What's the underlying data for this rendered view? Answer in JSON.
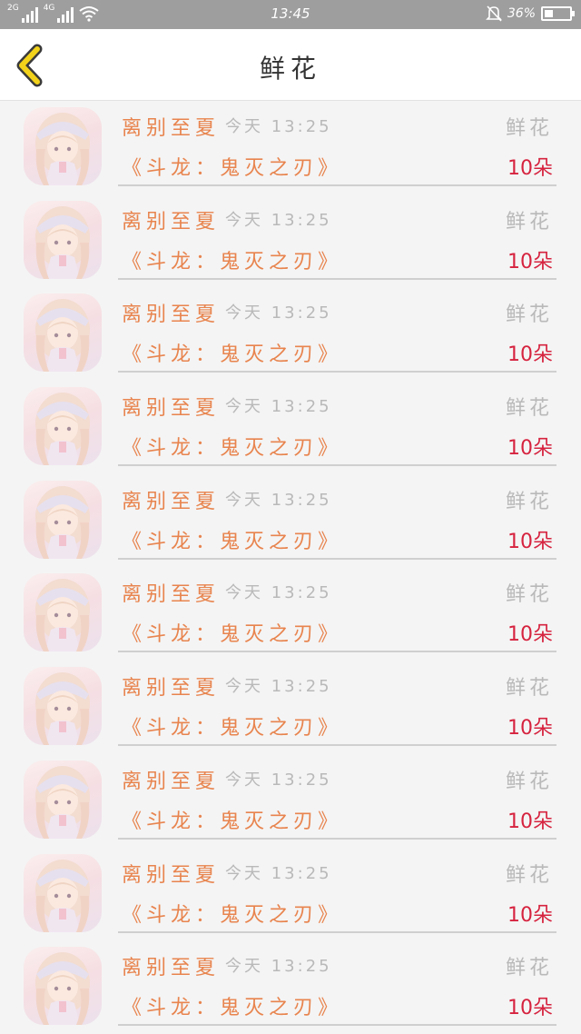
{
  "status_bar": {
    "network_1": "2G",
    "network_2": "4G",
    "time": "13:45",
    "battery_percent": "36%",
    "battery_level": 0.36,
    "icons": [
      "signal-icon",
      "wifi-icon",
      "mute-bell-icon",
      "battery-icon"
    ]
  },
  "header": {
    "title": "鲜花",
    "back_icon": "chevron-left-icon",
    "back_icon_color": "#f2d21b"
  },
  "colors": {
    "name": "#e8844e",
    "muted": "#b9b9b9",
    "count": "#d6233f"
  },
  "gift_records": [
    {
      "user": "离别至夏",
      "time": "今天 13:25",
      "gift": "鲜花",
      "book": "《斗龙：鬼灭之刃》",
      "count": "10朵"
    },
    {
      "user": "离别至夏",
      "time": "今天 13:25",
      "gift": "鲜花",
      "book": "《斗龙：鬼灭之刃》",
      "count": "10朵"
    },
    {
      "user": "离别至夏",
      "time": "今天 13:25",
      "gift": "鲜花",
      "book": "《斗龙：鬼灭之刃》",
      "count": "10朵"
    },
    {
      "user": "离别至夏",
      "time": "今天 13:25",
      "gift": "鲜花",
      "book": "《斗龙：鬼灭之刃》",
      "count": "10朵"
    },
    {
      "user": "离别至夏",
      "time": "今天 13:25",
      "gift": "鲜花",
      "book": "《斗龙：鬼灭之刃》",
      "count": "10朵"
    },
    {
      "user": "离别至夏",
      "time": "今天 13:25",
      "gift": "鲜花",
      "book": "《斗龙：鬼灭之刃》",
      "count": "10朵"
    },
    {
      "user": "离别至夏",
      "time": "今天 13:25",
      "gift": "鲜花",
      "book": "《斗龙：鬼灭之刃》",
      "count": "10朵"
    },
    {
      "user": "离别至夏",
      "time": "今天 13:25",
      "gift": "鲜花",
      "book": "《斗龙：鬼灭之刃》",
      "count": "10朵"
    },
    {
      "user": "离别至夏",
      "time": "今天 13:25",
      "gift": "鲜花",
      "book": "《斗龙：鬼灭之刃》",
      "count": "10朵"
    },
    {
      "user": "离别至夏",
      "time": "今天 13:25",
      "gift": "鲜花",
      "book": "《斗龙：鬼灭之刃》",
      "count": "10朵"
    }
  ]
}
